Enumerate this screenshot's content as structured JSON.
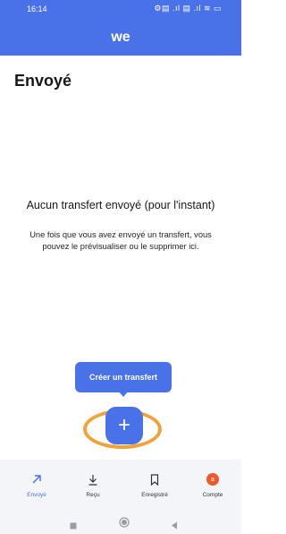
{
  "status_bar": {
    "time": "16:14",
    "indicators": "⚙▤ .ıl ▤ .ıl ≋ ▭"
  },
  "app_bar": {
    "logo": "we",
    "background": "#4a72e8"
  },
  "page": {
    "title": "Envoyé"
  },
  "empty_state": {
    "title": "Aucun transfert envoyé (pour l'instant)",
    "description": "Une fois que vous avez envoyé un transfert, vous pouvez le prévisualiser ou le supprimer ici."
  },
  "fab": {
    "tooltip": "Créer un transfert",
    "icon": "plus-icon",
    "label": "+"
  },
  "highlight": {
    "color": "#f1a33b"
  },
  "bottom_nav": {
    "items": [
      {
        "label": "Envoyé",
        "icon": "arrow-up-right-icon",
        "active": true
      },
      {
        "label": "Reçu",
        "icon": "download-icon",
        "active": false
      },
      {
        "label": "Enregistré",
        "icon": "bookmark-icon",
        "active": false
      },
      {
        "label": "Compte",
        "icon": "avatar-icon",
        "avatar_letter": "a",
        "active": false
      }
    ]
  },
  "system_nav": {
    "buttons": [
      "recents-icon",
      "home-icon",
      "back-icon"
    ]
  }
}
